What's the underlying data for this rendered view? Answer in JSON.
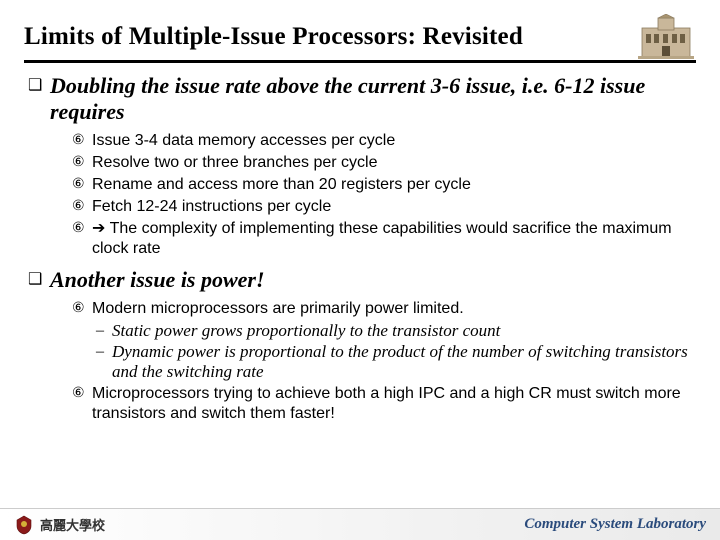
{
  "title": "Limits of Multiple-Issue Processors: Revisited",
  "section1": {
    "heading": "Doubling the issue rate above the current 3-6 issue, i.e. 6-12 issue requires",
    "items": [
      "Issue 3-4 data memory accesses per cycle",
      "Resolve two or three branches per cycle",
      "Rename and access more than 20 registers per cycle",
      "Fetch 12-24 instructions per cycle",
      "➔ The complexity of implementing these capabilities would sacrifice the maximum clock rate"
    ]
  },
  "section2": {
    "heading": "Another issue is power!",
    "items": [
      {
        "text": "Modern microprocessors are primarily power limited.",
        "sub": [
          "Static power grows proportionally to the transistor count",
          "Dynamic power is proportional to the product of the number of switching transistors and the switching rate"
        ]
      },
      {
        "text": "Microprocessors trying to achieve both a high IPC and a high CR must switch more transistors and switch them faster!",
        "sub": []
      }
    ]
  },
  "footer": {
    "left": "高麗大學校",
    "right": "Computer System Laboratory"
  },
  "bullets": {
    "l1": "❑",
    "l2": "⑥",
    "l3": "–"
  }
}
